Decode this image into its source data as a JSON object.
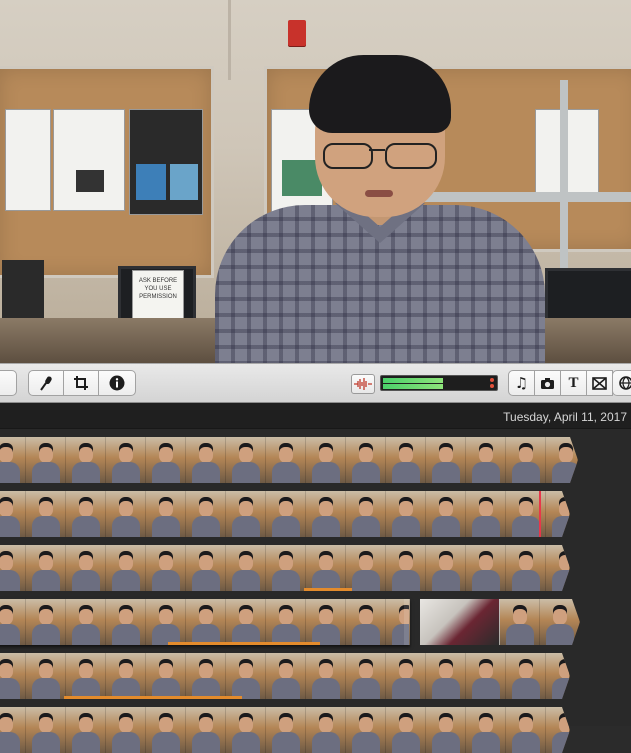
{
  "toolbar": {
    "buttons": [
      {
        "name": "voiceover-button",
        "icon": "microphone-icon"
      },
      {
        "name": "crop-button",
        "icon": "crop-icon"
      },
      {
        "name": "info-button",
        "icon": "info-icon"
      }
    ],
    "right_buttons": [
      {
        "name": "audio-browser-button",
        "icon": "music-note-icon",
        "glyph": "♫"
      },
      {
        "name": "photos-browser-button",
        "icon": "camera-icon",
        "glyph": "📷"
      },
      {
        "name": "titles-browser-button",
        "icon": "title-icon",
        "glyph": "T"
      },
      {
        "name": "transitions-browser-button",
        "icon": "transitions-icon",
        "glyph": "⊠"
      },
      {
        "name": "maps-browser-button",
        "icon": "globe-icon",
        "glyph": "🌐"
      }
    ],
    "volume_icon": "audio-waveform-icon"
  },
  "viewer": {
    "sign_text": "ASK BEFORE YOU USE PERMISSION"
  },
  "browser": {
    "date_label": "Tuesday, April 11, 2017",
    "rows": [
      {
        "clips": [
          14
        ]
      },
      {
        "clips": [
          14
        ]
      },
      {
        "clips": [
          14
        ]
      },
      {
        "clips": [
          10,
          4
        ]
      },
      {
        "clips": [
          14
        ]
      },
      {
        "clips": [
          14
        ]
      }
    ]
  },
  "colors": {
    "accent_orange": "#e38b2c",
    "playhead_red": "#e8374a",
    "meter_green": "#4bd06a"
  }
}
